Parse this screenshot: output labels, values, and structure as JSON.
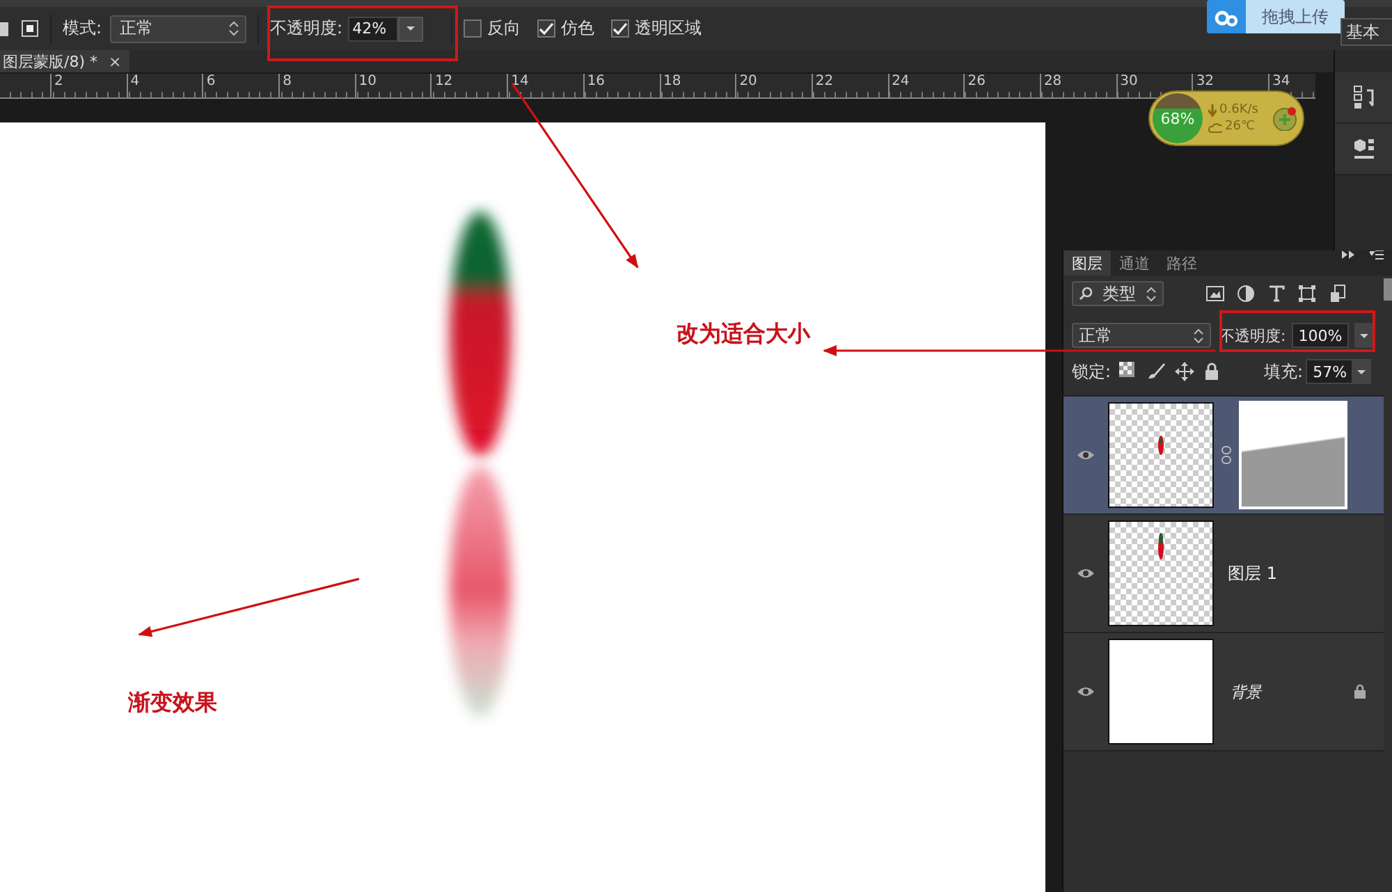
{
  "options_bar": {
    "mode_label": "模式:",
    "mode": "正常",
    "opacity_label": "不透明度:",
    "opacity": "42%",
    "checkboxes": [
      {
        "label": "反向",
        "checked": false
      },
      {
        "label": "仿色",
        "checked": true
      },
      {
        "label": "透明区域",
        "checked": true
      }
    ]
  },
  "upload_button": "拖拽上传",
  "workspace": "基本",
  "document_tab": {
    "title": "图层蒙版/8) *",
    "close": "×"
  },
  "ruler": [
    "2",
    "4",
    "6",
    "8",
    "10",
    "12",
    "14",
    "16",
    "18",
    "20",
    "22",
    "24",
    "26",
    "28",
    "30",
    "32",
    "34"
  ],
  "net_widget": {
    "usage": "68%",
    "speed": "0.6K/s",
    "temperature": "26℃"
  },
  "annotations": [
    {
      "text": "改为适合大小"
    },
    {
      "text": "渐变效果"
    }
  ],
  "layers_panel": {
    "tabs": [
      {
        "label": "图层",
        "selected": true
      },
      {
        "label": "通道",
        "selected": false
      },
      {
        "label": "路径",
        "selected": false
      }
    ],
    "filter": "类型",
    "blend_mode": "正常",
    "opacity_label": "不透明度:",
    "opacity": "100%",
    "lock_label": "锁定:",
    "fill_label": "填充:",
    "fill": "57%",
    "layers": [
      {
        "kind": "masked",
        "visible": true,
        "selected": true,
        "locked": false
      },
      {
        "kind": "pixel",
        "name": "图层 1",
        "visible": true,
        "selected": false,
        "locked": false
      },
      {
        "kind": "background",
        "name": "背景",
        "visible": true,
        "selected": false,
        "locked": true
      }
    ]
  }
}
